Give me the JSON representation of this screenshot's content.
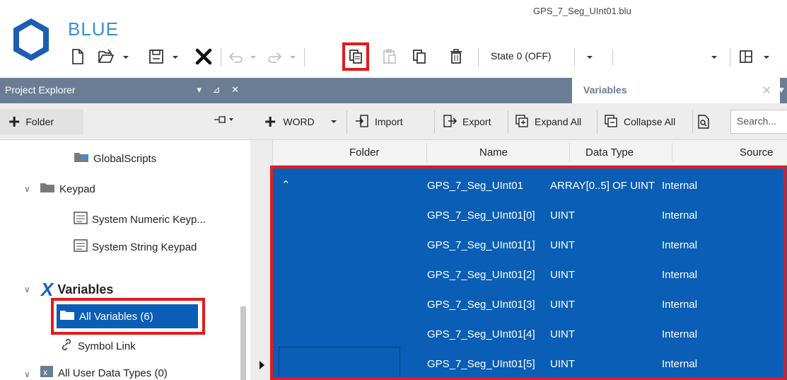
{
  "app": {
    "name": "BLUE",
    "file_name": "GPS_7_Seg_UInt01.blu"
  },
  "toolbar": {
    "state_label": "State 0 (OFF)",
    "icons": [
      "new-file-icon",
      "open-icon",
      "save-icon",
      "close-icon",
      "undo-icon",
      "redo-icon",
      "copy-icon",
      "paste-icon",
      "duplicate-icon",
      "delete-icon",
      "layout-icon"
    ],
    "highlighted": "copy-icon"
  },
  "project_explorer": {
    "title": "Project Explorer",
    "header_icons": "▾ ⊿ ✕",
    "add_folder_label": "Folder",
    "tree": {
      "global_scripts": "GlobalScripts",
      "keypad": "Keypad",
      "numeric_keypad": "System Numeric Keyp...",
      "string_keypad": "System String Keypad",
      "variables": "Variables",
      "all_variables": "All Variables (6)",
      "symbol_link": "Symbol Link",
      "all_user_data_types": "All User Data Types (0)"
    }
  },
  "variables_panel": {
    "tab_label": "Variables",
    "toolbar": {
      "add_type": "WORD",
      "import": "Import",
      "export": "Export",
      "expand_all": "Expand All",
      "collapse_all": "Collapse All",
      "search_placeholder": "Search..."
    },
    "columns": {
      "folder": "Folder",
      "name": "Name",
      "data_type": "Data Type",
      "source": "Source"
    },
    "rows": [
      {
        "name": "GPS_7_Seg_UInt01",
        "type": "ARRAY[0..5] OF UINT",
        "source": "Internal"
      },
      {
        "name": "GPS_7_Seg_UInt01[0]",
        "type": "UINT",
        "source": "Internal"
      },
      {
        "name": "GPS_7_Seg_UInt01[1]",
        "type": "UINT",
        "source": "Internal"
      },
      {
        "name": "GPS_7_Seg_UInt01[2]",
        "type": "UINT",
        "source": "Internal"
      },
      {
        "name": "GPS_7_Seg_UInt01[3]",
        "type": "UINT",
        "source": "Internal"
      },
      {
        "name": "GPS_7_Seg_UInt01[4]",
        "type": "UINT",
        "source": "Internal"
      },
      {
        "name": "GPS_7_Seg_UInt01[5]",
        "type": "UINT",
        "source": "Internal"
      }
    ]
  },
  "colors": {
    "selection": "#0a5eb5",
    "header_bar": "#6a7d94",
    "highlight": "#e51a1a",
    "brand": "#3a8fd8"
  }
}
